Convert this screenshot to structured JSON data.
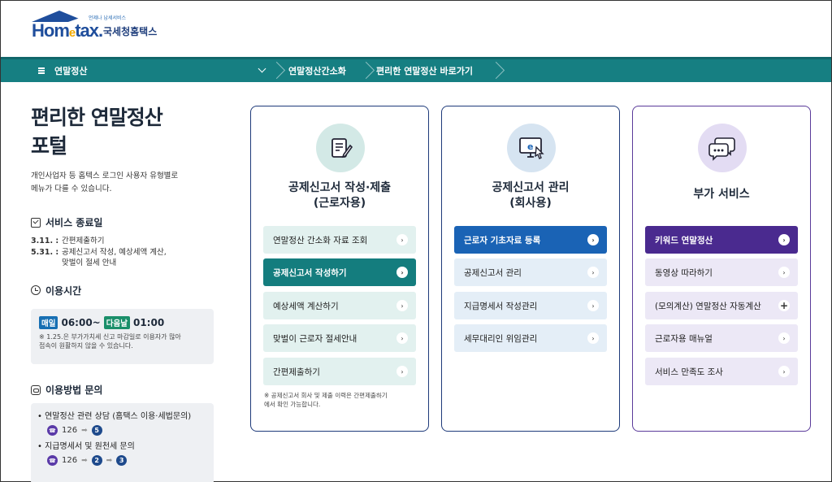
{
  "header": {
    "logo_sub": "언제나 납세서비스",
    "logo_word_1": "Hom",
    "logo_word_e": "e",
    "logo_word_2": "tax.",
    "logo_kr": "국세청홈택스"
  },
  "navbar": {
    "menu_label": "연말정산",
    "crumbs": [
      "연말정산간소화",
      "편리한 연말정산 바로가기"
    ]
  },
  "left": {
    "title_line1": "편리한 연말정산",
    "title_line2": "포털",
    "desc_line1": "개인사업자 등 홈텍스 로그인 사용자 유형별로",
    "desc_line2": "메뉴가 다를 수 있습니다.",
    "service_end_title": "서비스 종료일",
    "schedule": [
      {
        "date": "3.11. :",
        "text": "간편제출하기"
      },
      {
        "date": "5.31. :",
        "text": "공제신고서 작성, 예상세액 계산,"
      },
      {
        "date": "",
        "text": "맞벌이 절세 안내"
      }
    ],
    "hours_title": "이용시간",
    "hours": {
      "tag_daily": "매일",
      "start": "06:00~",
      "tag_next": "다음날",
      "end": "01:00",
      "note_line1": "※ 1.25.은 부가가치세 신고 마감일로 이용자가 많아",
      "note_line2": "접속이 원활하지 않을 수 있습니다."
    },
    "inquiry_title": "이용방법 문의",
    "inquiries": [
      {
        "text": "연말정산 관련 상담 (홈택스 이용·세법문의)",
        "phone": "126",
        "nums": [
          "5"
        ]
      },
      {
        "text": "지급명세서 및 원천세 문의",
        "phone": "126",
        "nums": [
          "2",
          "3"
        ]
      }
    ]
  },
  "cards": [
    {
      "title_line1": "공제신고서 작성·제출",
      "title_line2": "(근로자용)",
      "buttons": [
        "연말정산 간소화 자료 조회",
        "공제신고서 작성하기",
        "예상세액 계산하기",
        "맞벌이 근로자 절세안내",
        "간편제출하기"
      ],
      "note_line1": "※ 공제신고서 회사 및 제출 이력은 간편제출하기",
      "note_line2": "에서 확인 가능합니다."
    },
    {
      "title_line1": "공제신고서 관리",
      "title_line2": "(회사용)",
      "buttons": [
        "근로자 기초자료 등록",
        "공제신고서 관리",
        "지급명세서 작성관리",
        "세무대리인 위임관리"
      ]
    },
    {
      "title_line1": "부가 서비스",
      "buttons": [
        "키워드 연말정산",
        "동영상 따라하기",
        "(모의계산) 연말정산 자동계산",
        "근로자용 매뉴얼",
        "서비스 만족도 조사"
      ]
    }
  ],
  "icons": {
    "card1": "form-pen-icon",
    "card2": "e-monitor-icon",
    "card3": "chat-bubbles-icon",
    "arrow_symbol": "›",
    "plus_symbol": "+"
  },
  "colors": {
    "teal": "#167f82",
    "blue": "#1a63b5",
    "purple": "#4a2a8f",
    "navy": "#1e3a7a"
  }
}
